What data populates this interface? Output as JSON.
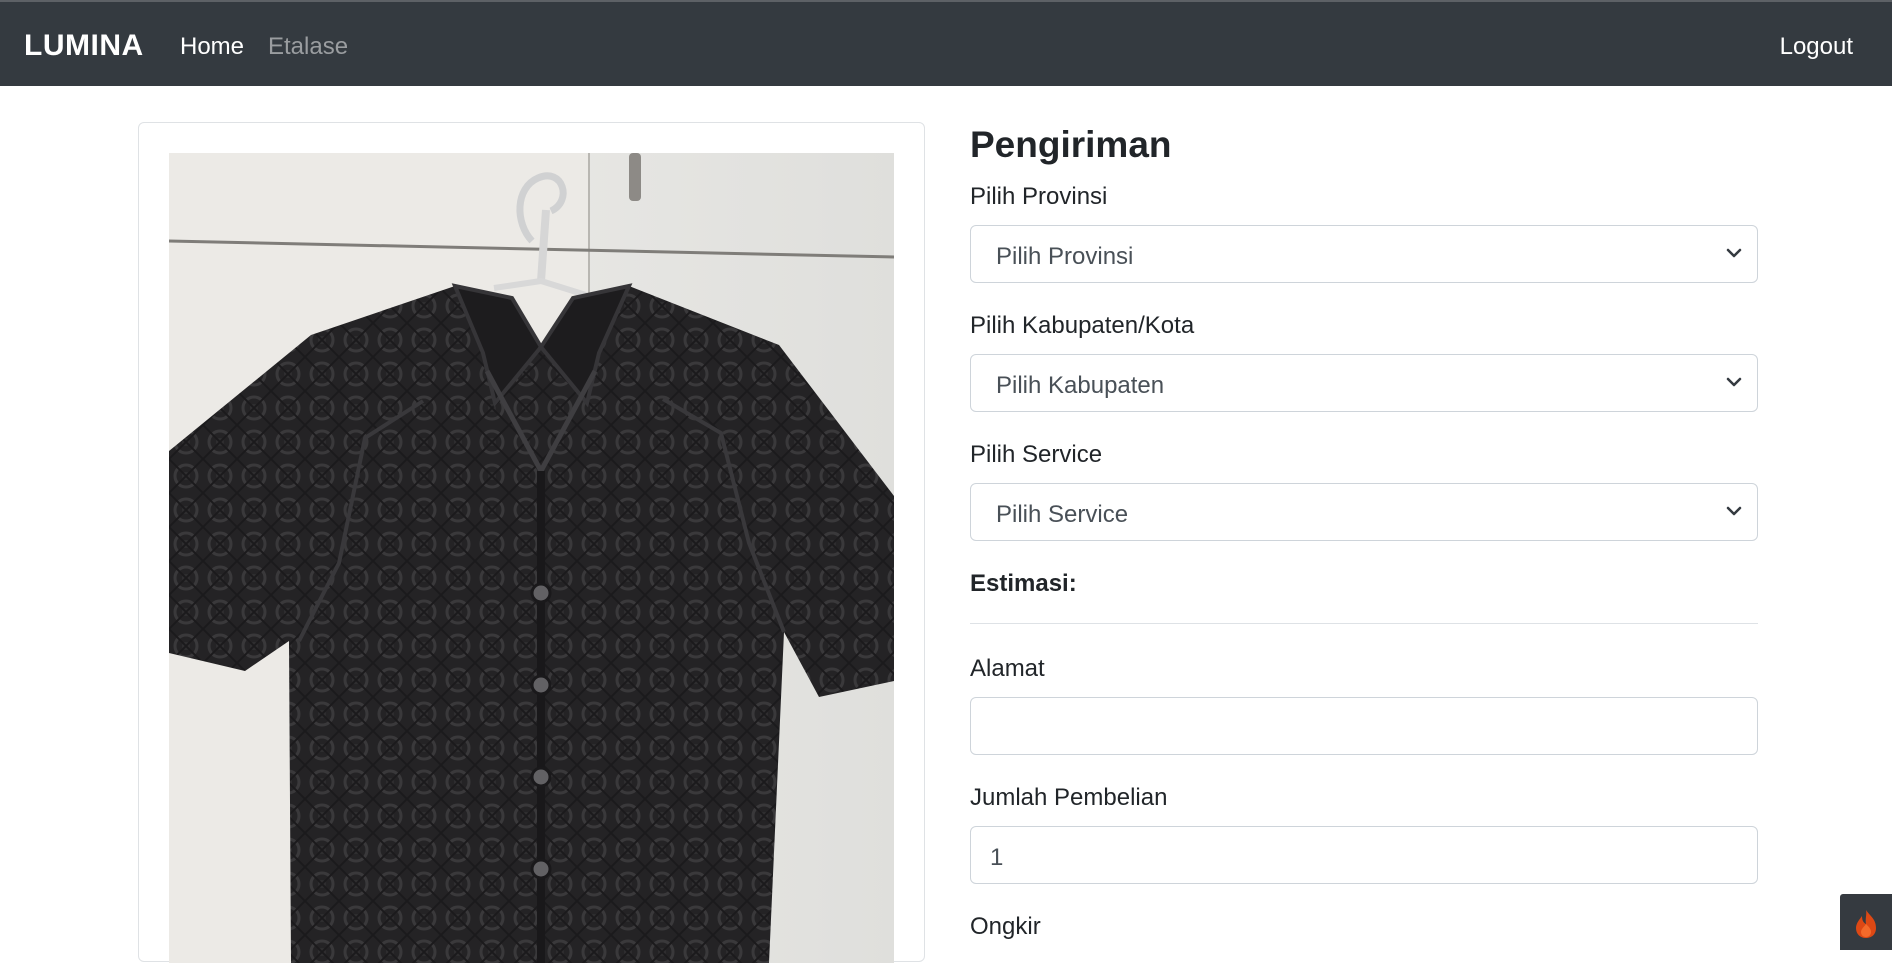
{
  "navbar": {
    "brand": "LUMINA",
    "links": [
      "Home",
      "Etalase"
    ],
    "logout": "Logout"
  },
  "product": {
    "image_alt": "black crochet short-sleeve shirt on hanger"
  },
  "shipping": {
    "title": "Pengiriman",
    "province": {
      "label": "Pilih Provinsi",
      "selected": "Pilih Provinsi"
    },
    "regency": {
      "label": "Pilih Kabupaten/Kota",
      "selected": "Pilih Kabupaten"
    },
    "service": {
      "label": "Pilih Service",
      "selected": "Pilih Service"
    },
    "estimate_label": "Estimasi:",
    "address": {
      "label": "Alamat",
      "value": ""
    },
    "quantity": {
      "label": "Jumlah Pembelian",
      "value": "1"
    },
    "shipping_cost_label": "Ongkir"
  },
  "colors": {
    "navbar_bg": "#343a40",
    "brand_text": "#ffffff",
    "muted_link": "#9a9da0",
    "input_border": "#ced4da",
    "debug_flame": "#dd4814"
  },
  "icons": {
    "select_arrow": "chevron-down-icon",
    "debug_toolbar": "flame-icon"
  }
}
